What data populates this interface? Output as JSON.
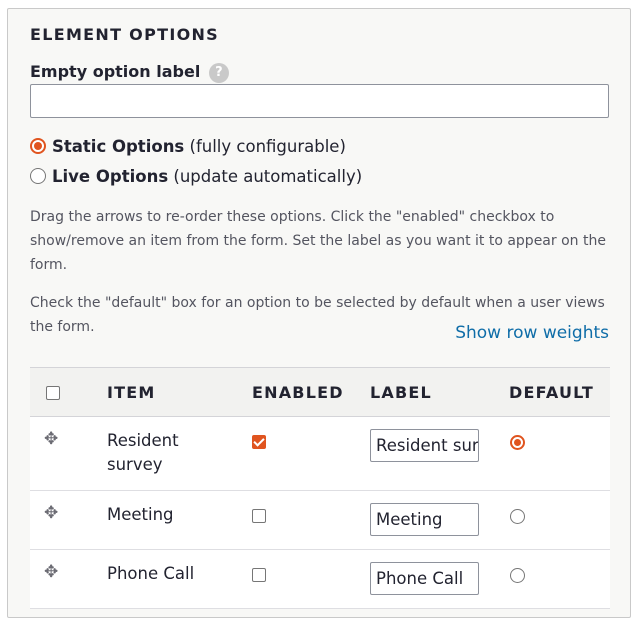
{
  "section": {
    "title": "ELEMENT OPTIONS"
  },
  "empty_option": {
    "label": "Empty option label",
    "help": "?",
    "value": ""
  },
  "options_source": [
    {
      "name": "Static Options",
      "note": "(fully configurable)",
      "selected": true
    },
    {
      "name": "Live Options",
      "note": "(update automatically)",
      "selected": false
    }
  ],
  "help_text": {
    "drag": "Drag the arrows to re-order these options. Click the \"enabled\" checkbox to show/remove an item from the form. Set the label as you want it to appear on the form.",
    "default": "Check the \"default\" box for an option to be selected by default when a user views the form."
  },
  "show_weights_link": "Show row weights",
  "table": {
    "headers": {
      "item": "ITEM",
      "enabled": "ENABLED",
      "label": "LABEL",
      "default": "DEFAULT"
    },
    "rows": [
      {
        "item": "Resident survey",
        "enabled": true,
        "label": "Resident survey",
        "default": true
      },
      {
        "item": "Meeting",
        "enabled": false,
        "label": "Meeting",
        "default": false
      },
      {
        "item": "Phone Call",
        "enabled": false,
        "label": "Phone Call",
        "default": false
      }
    ]
  },
  "colors": {
    "accent": "#e0541f",
    "link": "#0f6da8"
  }
}
